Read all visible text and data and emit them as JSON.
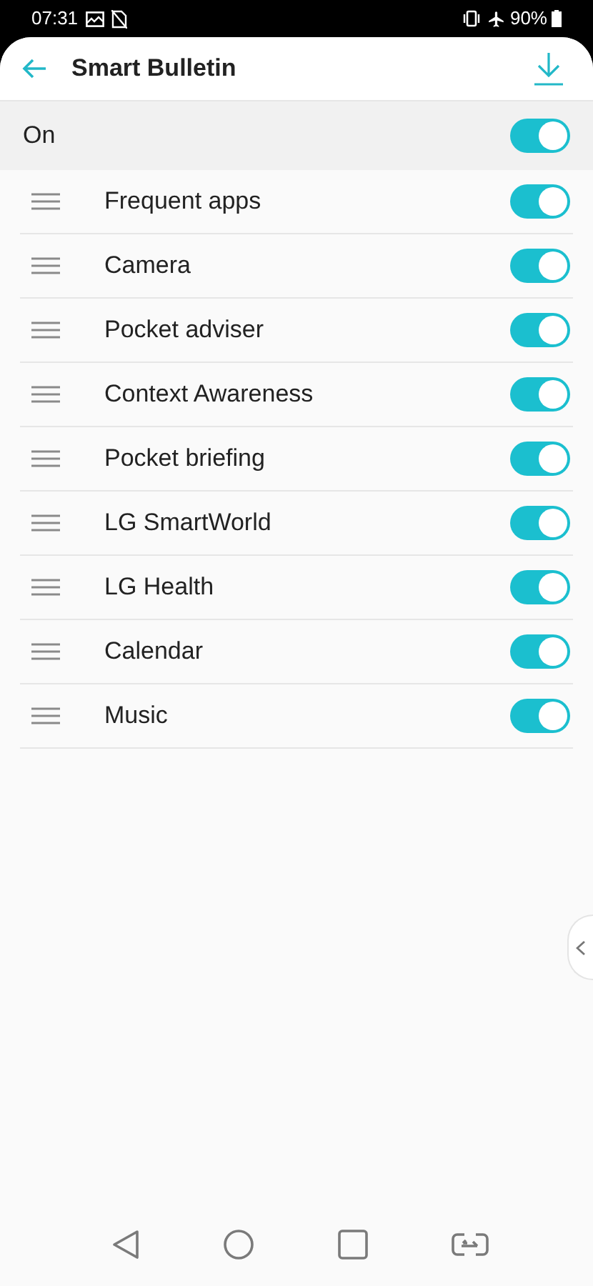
{
  "status_bar": {
    "time": "07:31",
    "battery": "90%"
  },
  "header": {
    "title": "Smart Bulletin"
  },
  "master": {
    "label": "On",
    "on": true
  },
  "items": [
    {
      "label": "Frequent apps",
      "on": true
    },
    {
      "label": "Camera",
      "on": true
    },
    {
      "label": "Pocket adviser",
      "on": true
    },
    {
      "label": "Context Awareness",
      "on": true
    },
    {
      "label": "Pocket briefing",
      "on": true
    },
    {
      "label": "LG SmartWorld",
      "on": true
    },
    {
      "label": "LG Health",
      "on": true
    },
    {
      "label": "Calendar",
      "on": true
    },
    {
      "label": "Music",
      "on": true
    }
  ]
}
